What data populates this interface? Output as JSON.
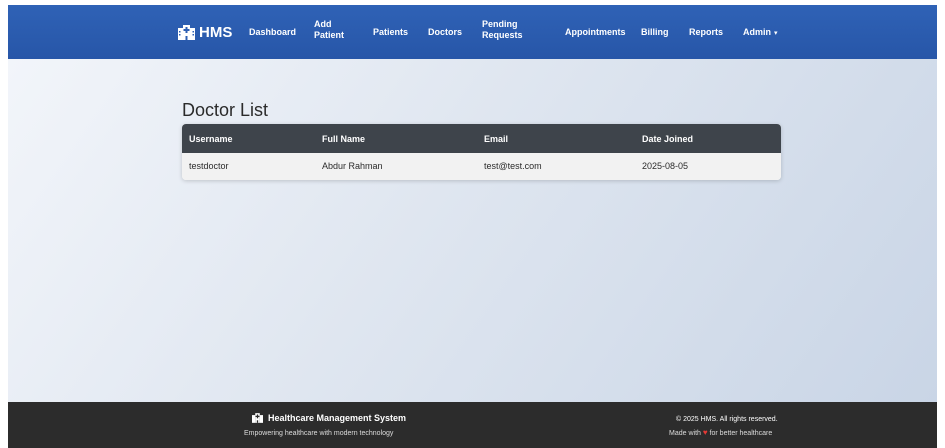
{
  "navbar": {
    "brand": "HMS",
    "items": [
      {
        "label": "Dashboard"
      },
      {
        "line1": "Add",
        "line2": "Patient"
      },
      {
        "label": "Patients"
      },
      {
        "label": "Doctors"
      },
      {
        "line1": "Pending",
        "line2": "Requests"
      },
      {
        "label": "Appointments"
      },
      {
        "label": "Billing"
      },
      {
        "label": "Reports"
      },
      {
        "label": "Admin",
        "caret": "▾"
      }
    ]
  },
  "main": {
    "title": "Doctor List",
    "table": {
      "headers": [
        "Username",
        "Full Name",
        "Email",
        "Date Joined"
      ],
      "rows": [
        [
          "testdoctor",
          "Abdur Rahman",
          "test@test.com",
          "2025-08-05"
        ]
      ]
    }
  },
  "footer": {
    "title": "Healthcare Management System",
    "subtitle": "Empowering healthcare with modern technology",
    "copyright": "© 2025 HMS. All rights reserved.",
    "made_with_prefix": "Made with",
    "heart": "♥",
    "made_with_suffix": "for better healthcare"
  },
  "colors": {
    "navbar": "#2d5fb3",
    "table_header": "#3e444b",
    "footer": "#2c2c2c",
    "heart": "#e53935"
  },
  "icons": {
    "brand": "hospital-icon",
    "footer": "hospital-icon",
    "dropdown": "caret-down-icon"
  }
}
